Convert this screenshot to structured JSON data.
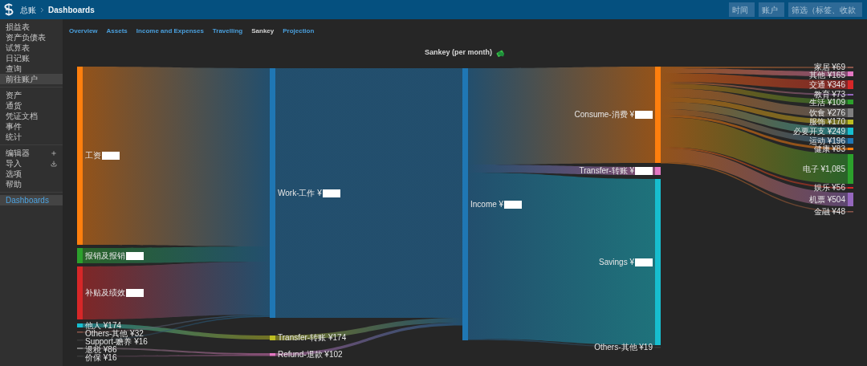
{
  "header": {
    "app_title": "总账",
    "breadcrumb": "Dashboards",
    "filters": [
      {
        "placeholder": "时间"
      },
      {
        "placeholder": "账户"
      },
      {
        "placeholder": "筛选（标签、收款"
      }
    ]
  },
  "sidebar": {
    "groups": [
      [
        {
          "label": "损益表",
          "selected": false,
          "current": false
        },
        {
          "label": "资产负债表",
          "selected": false,
          "current": false
        },
        {
          "label": "试算表",
          "selected": false,
          "current": false
        },
        {
          "label": "日记账",
          "selected": false,
          "current": false
        },
        {
          "label": "查询",
          "selected": false,
          "current": false
        },
        {
          "label": "前往账户",
          "selected": true,
          "current": false
        }
      ],
      [
        {
          "label": "资产",
          "selected": false,
          "current": false
        },
        {
          "label": "通货",
          "selected": false,
          "current": false
        },
        {
          "label": "凭证文档",
          "selected": false,
          "current": false
        },
        {
          "label": "事件",
          "selected": false,
          "current": false
        },
        {
          "label": "统计",
          "selected": false,
          "current": false
        }
      ],
      [
        {
          "label": "编辑器",
          "selected": false,
          "current": false,
          "kind": "add"
        },
        {
          "label": "导入",
          "selected": false,
          "current": false,
          "kind": "download"
        },
        {
          "label": "选项",
          "selected": false,
          "current": false
        },
        {
          "label": "帮助",
          "selected": false,
          "current": false
        }
      ],
      [
        {
          "label": "Dashboards",
          "selected": true,
          "current": true
        }
      ]
    ]
  },
  "tabs": [
    {
      "label": "Overview",
      "selected": false
    },
    {
      "label": "Assets",
      "selected": false
    },
    {
      "label": "Income and Expenses",
      "selected": false
    },
    {
      "label": "Travelling",
      "selected": false
    },
    {
      "label": "Sankey",
      "selected": true
    },
    {
      "label": "Projection",
      "selected": false
    }
  ],
  "chart": {
    "title": "Sankey (per month)",
    "columns": [
      [
        {
          "label": "工资",
          "color": "#ff7f0e",
          "redacted": true
        },
        {
          "label": "报销及报销",
          "color": "#2ca02c",
          "redacted": true
        },
        {
          "label": "补贴及绩效",
          "color": "#d62728",
          "redacted": true
        },
        {
          "label": "他人 ¥174",
          "color": "#17becf",
          "redacted": false
        },
        {
          "label": "Others-其他 ¥32",
          "color": "#8c564b",
          "redacted": false
        },
        {
          "label": "Support-赡养 ¥16",
          "color": "#3a3a3a",
          "redacted": false
        },
        {
          "label": "退税 ¥86",
          "color": "#7f7f7f",
          "redacted": false
        },
        {
          "label": "价保 ¥16",
          "color": "#3a3a3a",
          "redacted": false
        }
      ],
      [
        {
          "label": "Work-工作 ¥",
          "color": "#1f77b4",
          "redacted": true
        },
        {
          "label": "Transfer-转账 ¥174",
          "color": "#bcbd22",
          "redacted": false
        },
        {
          "label": "Refund-退款 ¥102",
          "color": "#e377c2",
          "redacted": false
        }
      ],
      [
        {
          "label": "Income ¥",
          "color": "#1f77b4",
          "redacted": true
        }
      ],
      [
        {
          "label": "Consume-消费 ¥",
          "color": "#ff7f0e",
          "redacted": true
        },
        {
          "label": "Transfer-转账 ¥",
          "color": "#e377c2",
          "redacted": true
        },
        {
          "label": "Savings ¥",
          "color": "#17becf",
          "redacted": true
        },
        {
          "label": "Others-其他 ¥19",
          "color": "#3a3a3a",
          "redacted": false
        }
      ],
      [
        {
          "label": "家居 ¥69",
          "color": "#8c564b",
          "redacted": false
        },
        {
          "label": "其他 ¥165",
          "color": "#e377c2",
          "redacted": false
        },
        {
          "label": "交通 ¥346",
          "color": "#d62728",
          "redacted": false
        },
        {
          "label": "教育 ¥73",
          "color": "#9467bd",
          "redacted": false
        },
        {
          "label": "生活 ¥109",
          "color": "#2ca02c",
          "redacted": false
        },
        {
          "label": "饮食 ¥276",
          "color": "#7f7f7f",
          "redacted": false
        },
        {
          "label": "服饰 ¥170",
          "color": "#bcbd22",
          "redacted": false
        },
        {
          "label": "必要开支 ¥249",
          "color": "#17becf",
          "redacted": false
        },
        {
          "label": "运动 ¥196",
          "color": "#1f77b4",
          "redacted": false
        },
        {
          "label": "健康 ¥83",
          "color": "#ff7f0e",
          "redacted": false
        },
        {
          "label": "电子 ¥1,085",
          "color": "#2ca02c",
          "redacted": false
        },
        {
          "label": "娱乐 ¥56",
          "color": "#d62728",
          "redacted": false
        },
        {
          "label": "机票 ¥504",
          "color": "#9467bd",
          "redacted": false
        },
        {
          "label": "金融 ¥48",
          "color": "#8c564b",
          "redacted": false
        }
      ]
    ]
  }
}
